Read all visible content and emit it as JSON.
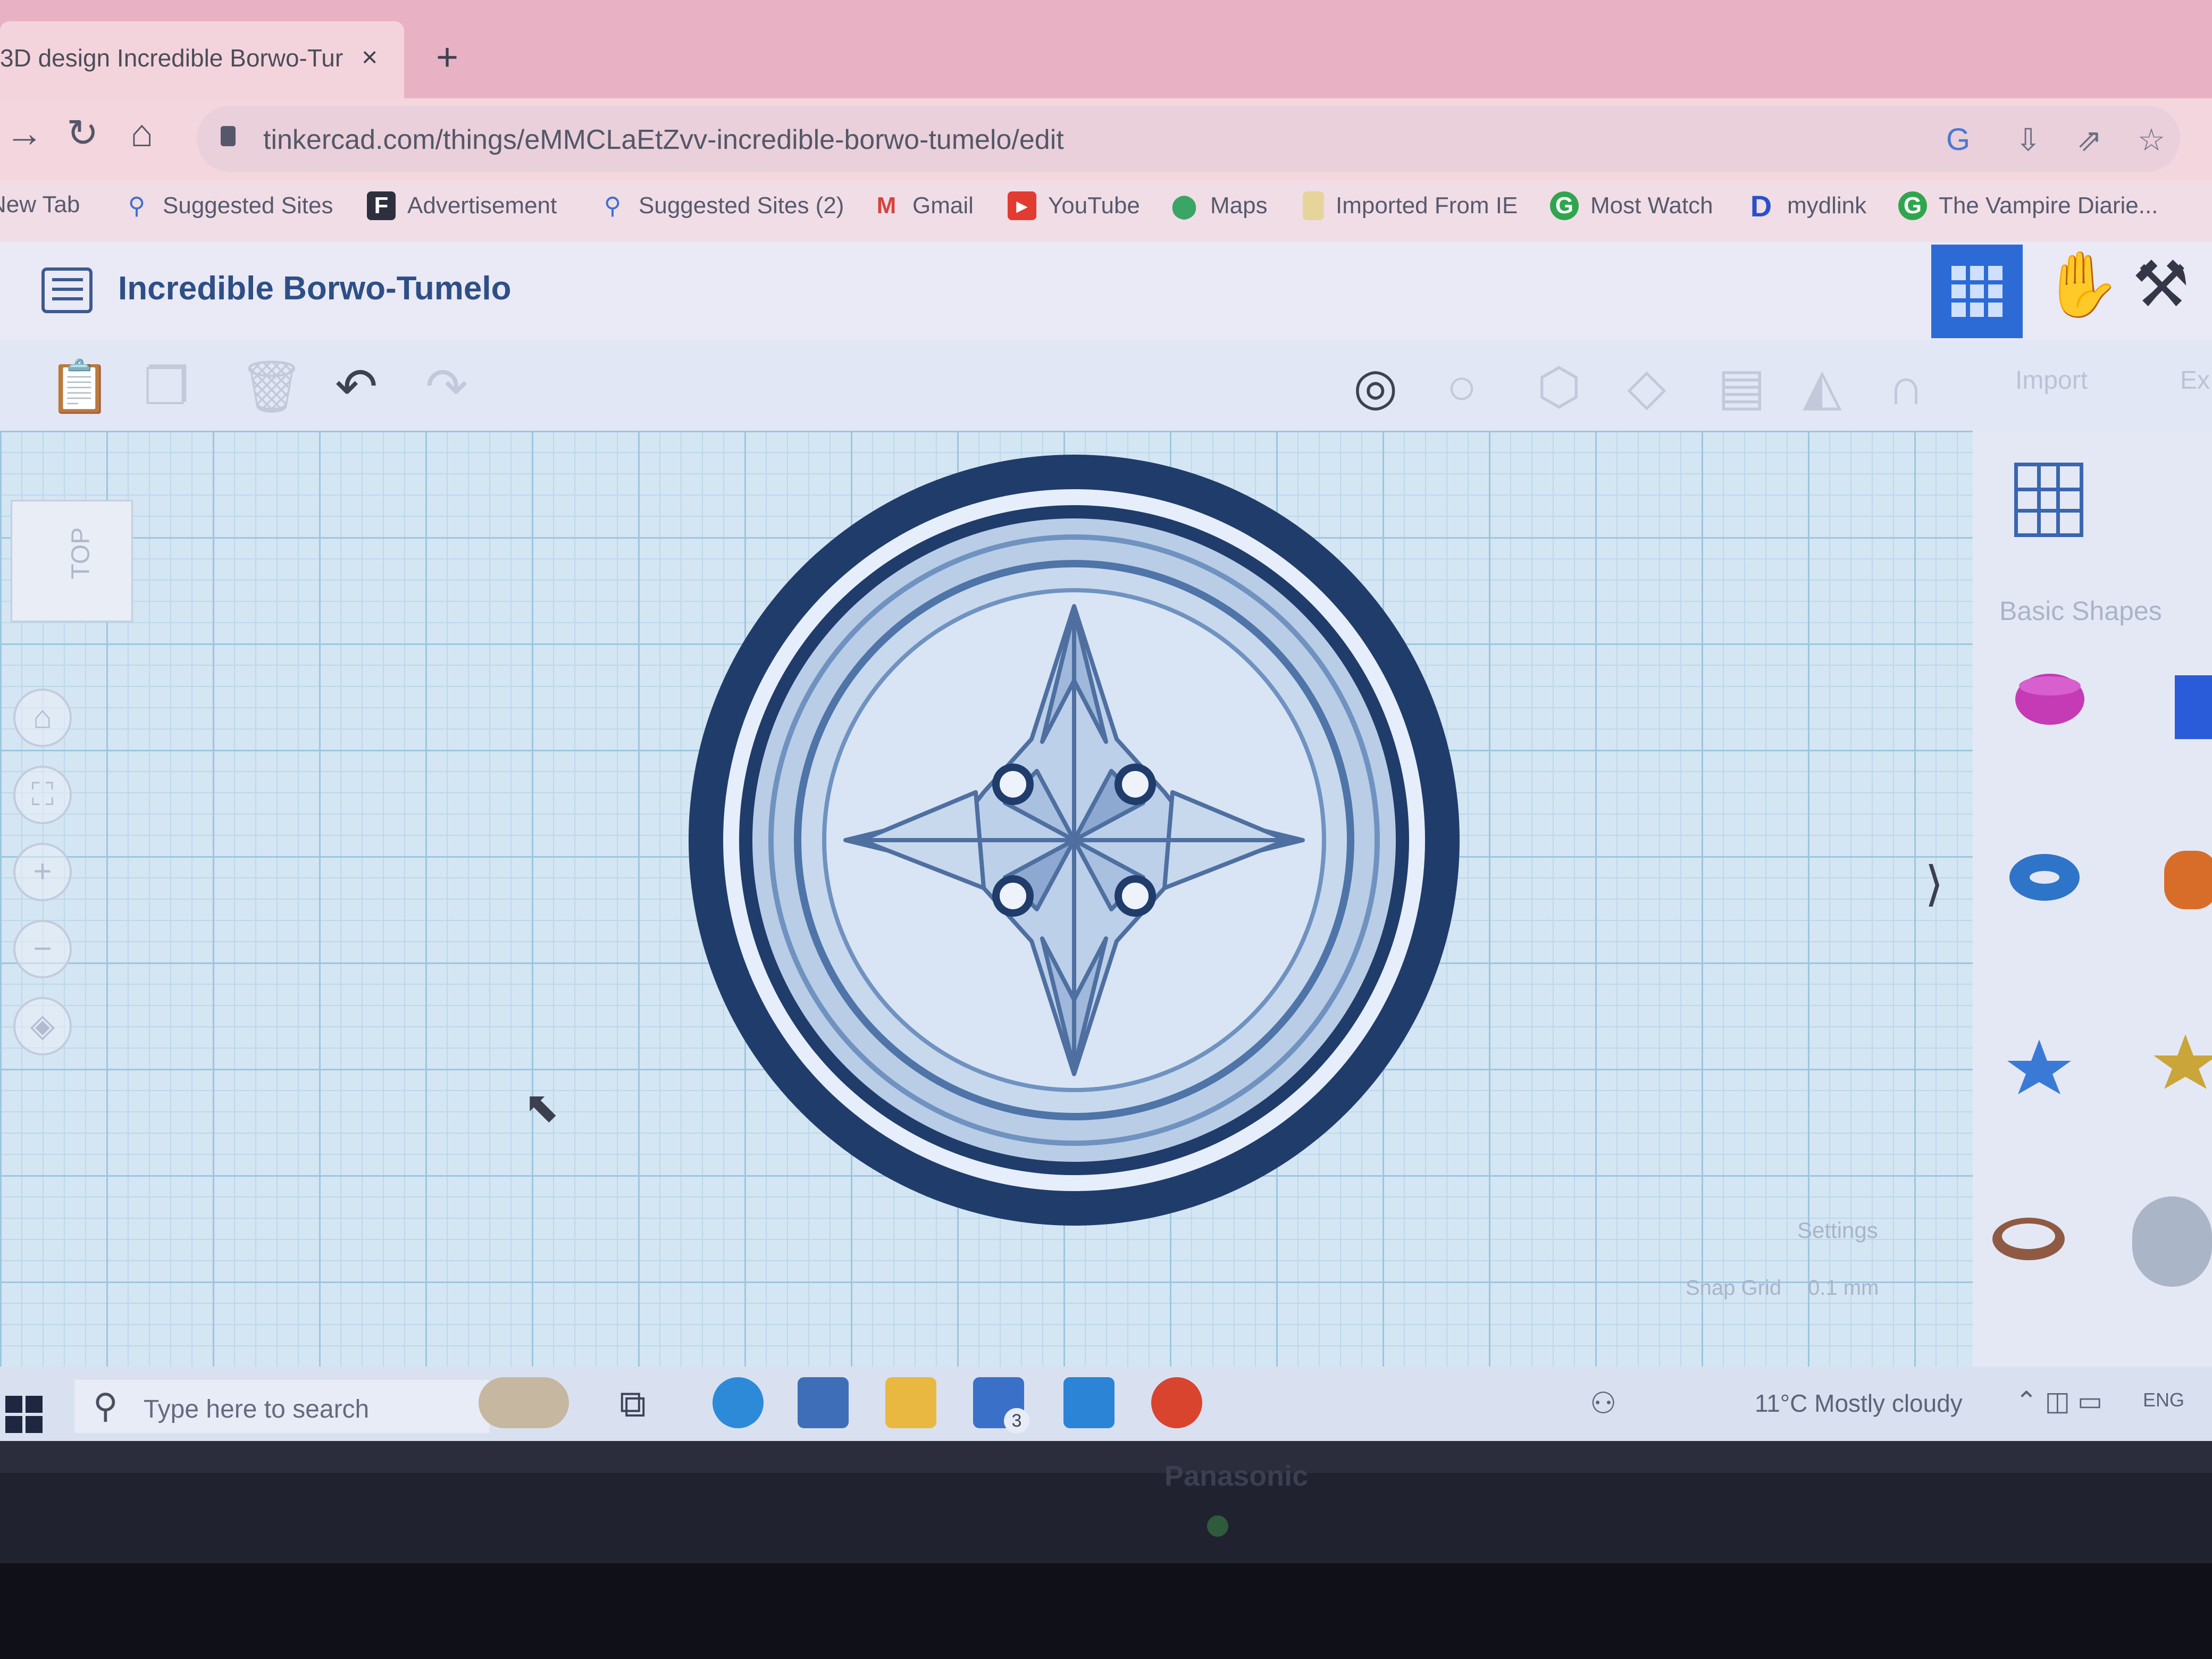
{
  "browser": {
    "tab_title": "3D design Incredible Borwo-Tur",
    "tab_close": "×",
    "new_tab": "+",
    "url": "tinkercad.com/things/eMMCLaEtZvv-incredible-borwo-tumelo/edit"
  },
  "bookmarks": [
    {
      "label": "New Tab",
      "icon": "tab-icon"
    },
    {
      "label": "Suggested Sites",
      "icon": "search-icon"
    },
    {
      "label": "Advertisement",
      "icon": "facebook-icon"
    },
    {
      "label": "Suggested Sites (2)",
      "icon": "search-icon"
    },
    {
      "label": "Gmail",
      "icon": "gmail-icon"
    },
    {
      "label": "YouTube",
      "icon": "youtube-icon"
    },
    {
      "label": "Maps",
      "icon": "maps-pin-icon"
    },
    {
      "label": "Imported From IE",
      "icon": "folder-icon"
    },
    {
      "label": "Most Watch",
      "icon": "green-circle-icon"
    },
    {
      "label": "mydlink",
      "icon": "d-logo-icon"
    },
    {
      "label": "The Vampire Diarie...",
      "icon": "green-circle-icon"
    }
  ],
  "tinkercad": {
    "design_title": "Incredible Borwo-Tumelo",
    "import_label": "Import",
    "export_label": "Ex",
    "viewcube_label": "TOP",
    "settings_label": "Settings",
    "snap_grid_label": "Snap Grid",
    "snap_grid_value": "0.1 mm",
    "shapes_category": "Basic Shapes"
  },
  "taskbar": {
    "search_placeholder": "Type here to search",
    "weather": "11°C  Mostly cloudy",
    "language": "ENG",
    "mail_badge": "3"
  },
  "monitor": {
    "brand": "Panasonic"
  },
  "colors": {
    "accent": "#2c6bd6",
    "model_dark": "#1f3c6b",
    "model_mid": "#6f92c0",
    "model_light": "#b9cde6",
    "workplane": "#d4e6f3"
  }
}
